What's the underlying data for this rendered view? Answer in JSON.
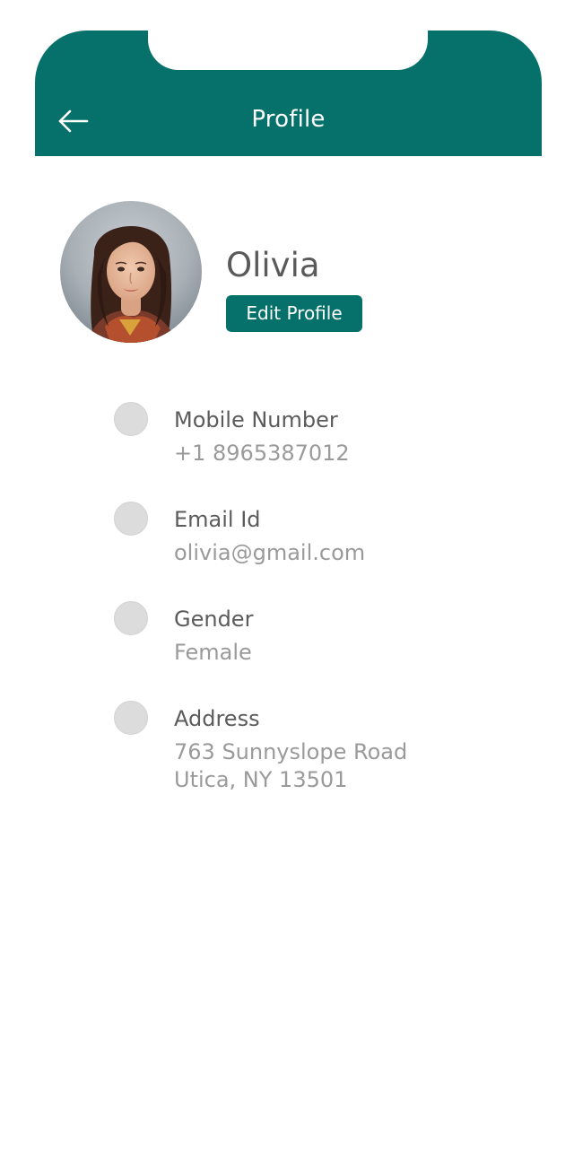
{
  "header": {
    "title": "Profile",
    "back_icon": "arrow-left-icon",
    "color": "#06706a"
  },
  "profile": {
    "name": "Olivia",
    "edit_button_label": "Edit Profile",
    "avatar": "avatar-photo"
  },
  "fields": [
    {
      "label": "Mobile Number",
      "value": "+1 8965387012"
    },
    {
      "label": "Email Id",
      "value": "olivia@gmail.com"
    },
    {
      "label": "Gender",
      "value": "Female"
    },
    {
      "label": "Address",
      "value_line1": "763 Sunnyslope Road",
      "value_line2": "Utica, NY 13501"
    }
  ]
}
